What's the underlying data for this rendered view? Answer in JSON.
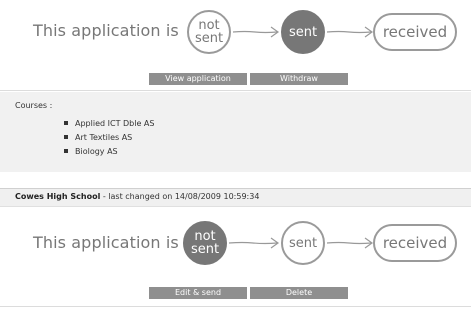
{
  "application_1": {
    "status_label": "This application is",
    "steps": [
      {
        "label_line1": "not",
        "label_line2": "sent",
        "state": "inactive"
      },
      {
        "label": "sent",
        "state": "active"
      },
      {
        "label": "received",
        "state": "inactive"
      }
    ],
    "actions": {
      "view_label": "View application",
      "withdraw_label": "Withdraw"
    },
    "courses": {
      "label": "Courses :",
      "items": [
        "Applied ICT Dble AS",
        "Art Textiles AS",
        "Biology AS"
      ]
    }
  },
  "application_2": {
    "school": "Cowes High School",
    "last_changed": " - last changed on 14/08/2009 10:59:34",
    "status_label": "This application is",
    "steps": [
      {
        "label_line1": "not",
        "label_line2": "sent",
        "state": "active"
      },
      {
        "label": "sent",
        "state": "inactive"
      },
      {
        "label": "received",
        "state": "inactive"
      }
    ],
    "actions": {
      "edit_label": "Edit & send",
      "delete_label": "Delete"
    }
  },
  "colors": {
    "active_fill": "#777777",
    "inactive_border": "#9a9a9a",
    "button_fill": "#8f8f8f"
  }
}
